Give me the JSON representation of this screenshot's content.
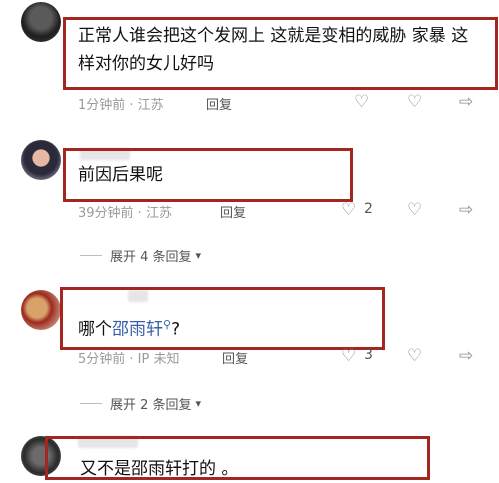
{
  "comments": [
    {
      "text": "正常人谁会把这个发网上 这就是变相的威胁 家暴 这样对你的女儿好吗",
      "meta": "1分钟前 · 江苏",
      "reply": "回复",
      "likes": ""
    },
    {
      "text": "前因后果呢",
      "meta": "39分钟前 · 江苏",
      "reply": "回复",
      "likes": "2"
    },
    {
      "text_before": "哪个",
      "mention": "邵雨轩",
      "text_after": "?",
      "meta": "5分钟前 · IP 未知",
      "reply": "回复",
      "likes": "3"
    },
    {
      "text": "又不是邵雨轩打的 。"
    }
  ],
  "expand_replies": [
    {
      "label": "展开 4 条回复"
    },
    {
      "label": "展开 2 条回复"
    }
  ],
  "icons": {
    "like": "heart-icon",
    "dislike": "broken-heart-icon",
    "share": "share-arrow-icon",
    "mention_search": "search-icon"
  },
  "colors": {
    "highlight_border": "#a3261f",
    "mention": "#3a5fa8"
  }
}
